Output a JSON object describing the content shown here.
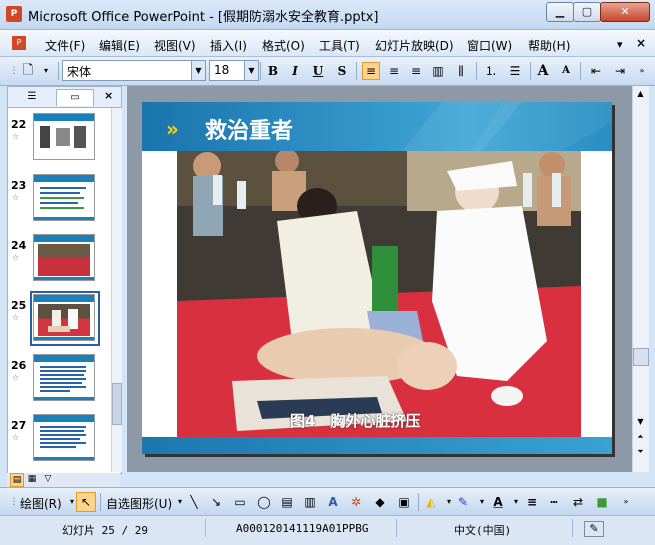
{
  "window": {
    "title": "Microsoft Office PowerPoint - [假期防溺水安全教育.pptx]",
    "app_icon": "P",
    "min_glyph": "▁",
    "max_glyph": "▢",
    "close_glyph": "✕"
  },
  "menu": {
    "items": [
      "文件(F)",
      "编辑(E)",
      "视图(V)",
      "插入(I)",
      "格式(O)",
      "工具(T)",
      "幻灯片放映(D)",
      "窗口(W)",
      "帮助(H)"
    ],
    "close_doc_glyph": "×"
  },
  "toolbar": {
    "font_name": "宋体",
    "font_size": "18",
    "bold": "B",
    "italic": "I",
    "underline": "U",
    "shadow": "S",
    "grow_font": "A",
    "shrink_font": "A"
  },
  "panel": {
    "close_glyph": "×",
    "slides": [
      {
        "number": "22"
      },
      {
        "number": "23"
      },
      {
        "number": "24"
      },
      {
        "number": "25"
      },
      {
        "number": "26"
      },
      {
        "number": "27"
      }
    ],
    "selected_slide": "25"
  },
  "slide": {
    "arrows": "»",
    "title": "救治重者",
    "caption": "图4　胸外心脏挤压"
  },
  "drawbar": {
    "draw_label": "绘图(R)",
    "autoshapes_label": "自选图形(U)"
  },
  "status": {
    "slide_info": "幻灯片 25 / 29",
    "template": "A000120141119A01PPBG",
    "language": "中文(中国)"
  }
}
